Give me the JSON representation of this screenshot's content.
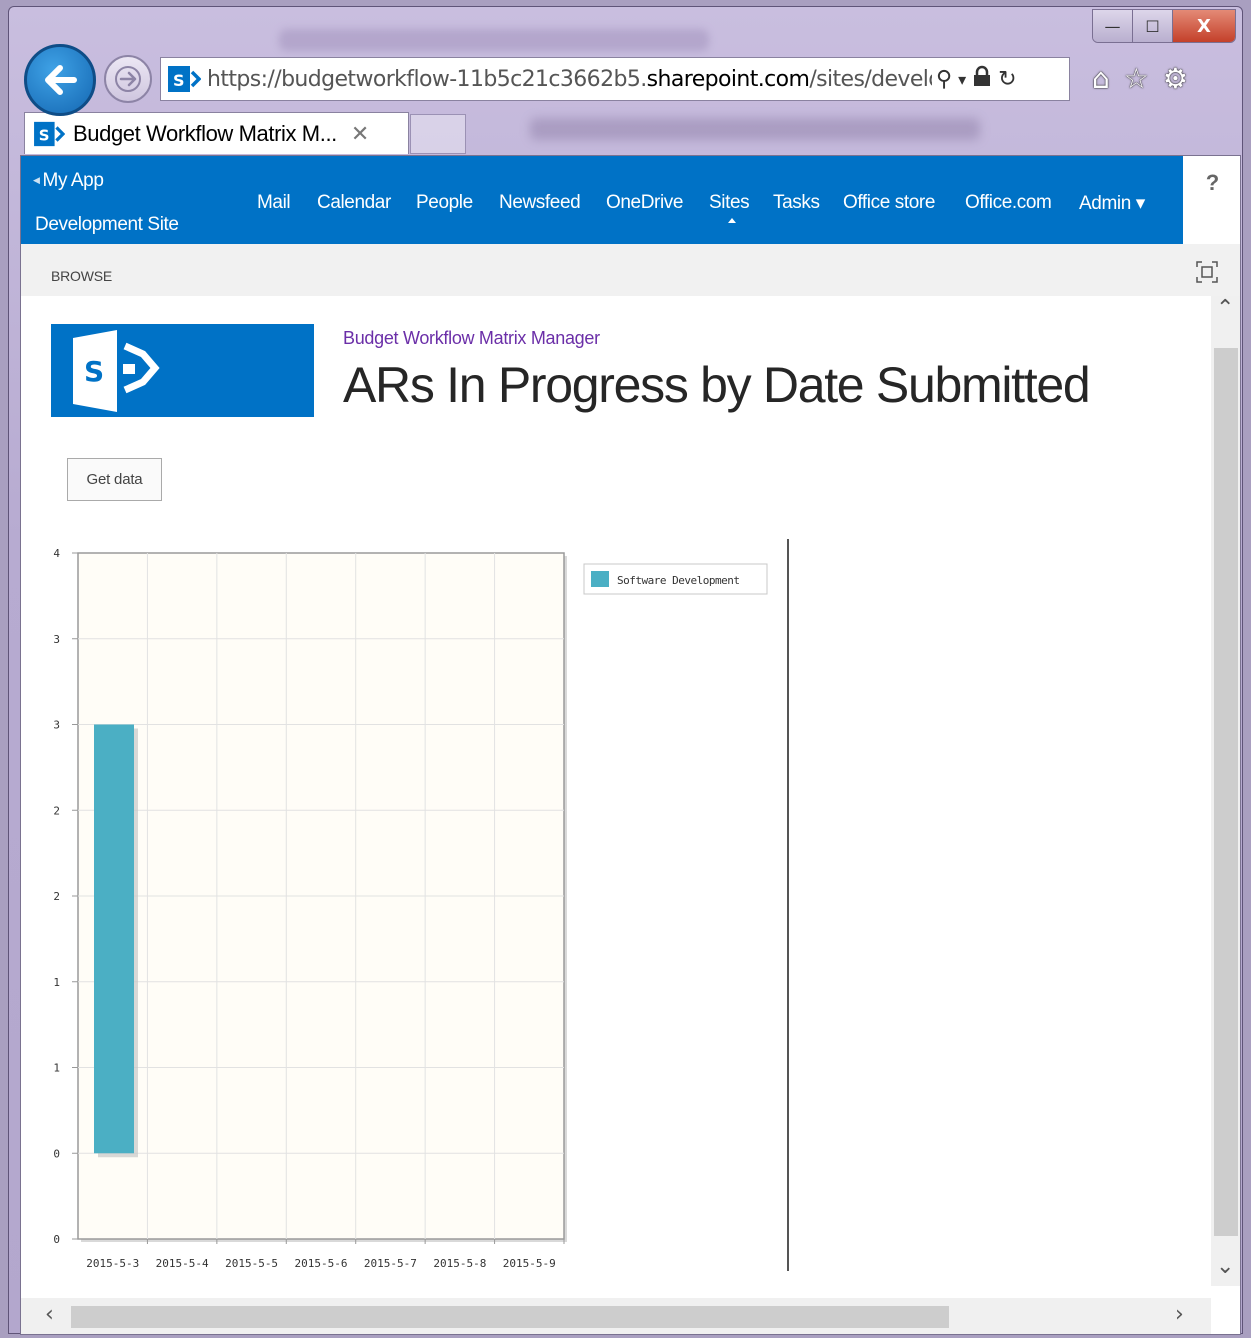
{
  "browser": {
    "url_prefix": "https://",
    "url_domain_start": "budgetworkflow-11b5c21c3662b5.",
    "url_domain_main": "sharepoint.com",
    "url_path": "/sites/develo",
    "tab_title": "Budget Workflow Matrix M...",
    "tab_close": "✕",
    "window_minimize": "—",
    "window_maximize": "☐",
    "window_close": "X",
    "search_icon_glyph": "⚲",
    "dropdown_glyph": "▾",
    "lock_glyph": "🔒",
    "refresh_glyph": "↻",
    "home_glyph": "⌂",
    "favorites_glyph": "☆",
    "tools_glyph": "⚙"
  },
  "suitebar": {
    "my_app": "My App",
    "site_name": "Development Site",
    "help": "?",
    "nav": [
      {
        "label": "Mail"
      },
      {
        "label": "Calendar"
      },
      {
        "label": "People"
      },
      {
        "label": "Newsfeed"
      },
      {
        "label": "OneDrive"
      },
      {
        "label": "Sites"
      },
      {
        "label": "Tasks"
      },
      {
        "label": "Office store"
      },
      {
        "label": "Office.com"
      },
      {
        "label": "Admin ▾"
      }
    ]
  },
  "ribbon": {
    "browse": "BROWSE"
  },
  "page": {
    "site_title": "Budget Workflow Matrix Manager",
    "title": "ARs In Progress by Date Submitted",
    "get_data_button": "Get data"
  },
  "colors": {
    "suitebar": "#0072c6",
    "bar": "#4bafc4",
    "plot_bg": "#fffdf7"
  },
  "chart_data": {
    "type": "bar",
    "categories": [
      "2015-5-3",
      "2015-5-4",
      "2015-5-5",
      "2015-5-6",
      "2015-5-7",
      "2015-5-8",
      "2015-5-9"
    ],
    "series": [
      {
        "name": "Software Development",
        "values": [
          3,
          null,
          null,
          null,
          null,
          null,
          null
        ]
      }
    ],
    "ylim": [
      0,
      4
    ],
    "y_tick_labels": [
      "0",
      "0",
      "1",
      "1",
      "2",
      "2",
      "3",
      "3",
      "4"
    ],
    "grid": true,
    "legend_position": "right"
  }
}
